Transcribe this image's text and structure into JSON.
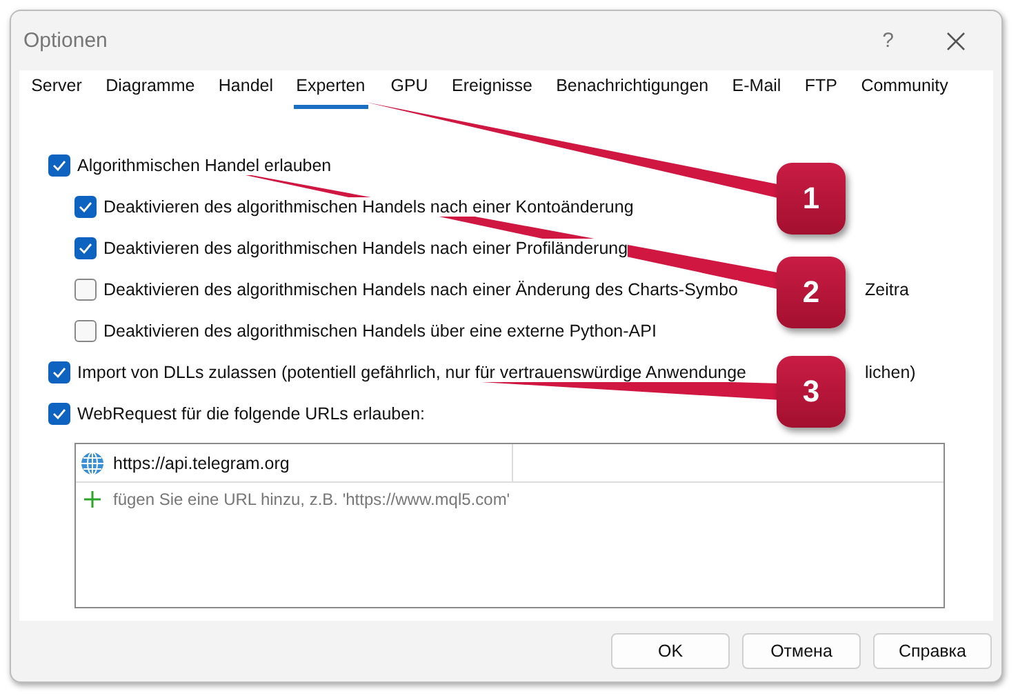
{
  "window": {
    "title": "Optionen",
    "help": "?"
  },
  "tabs": [
    {
      "label": "Server",
      "selected": false
    },
    {
      "label": "Diagramme",
      "selected": false
    },
    {
      "label": "Handel",
      "selected": false
    },
    {
      "label": "Experten",
      "selected": true
    },
    {
      "label": "GPU",
      "selected": false
    },
    {
      "label": "Ereignisse",
      "selected": false
    },
    {
      "label": "Benachrichtigungen",
      "selected": false
    },
    {
      "label": "E-Mail",
      "selected": false
    },
    {
      "label": "FTP",
      "selected": false
    },
    {
      "label": "Community",
      "selected": false
    }
  ],
  "options": [
    {
      "label": "Algorithmischen Handel erlauben",
      "checked": true,
      "children": [
        {
          "label": "Deaktivieren des algorithmischen Handels nach einer Kontoänderung",
          "checked": true
        },
        {
          "label": "Deaktivieren des algorithmischen Handels nach einer Profiländerung",
          "checked": true
        },
        {
          "label": "Deaktivieren des algorithmischen Handels nach einer Änderung des Charts-Symbo",
          "tail": "Zeitra",
          "checked": false
        },
        {
          "label": "Deaktivieren des algorithmischen Handels über eine externe Python-API",
          "checked": false
        }
      ]
    },
    {
      "label": "Import von DLLs zulassen (potentiell gefährlich, nur für vertrauenswürdige Anwendunge",
      "tail": "lichen)",
      "checked": true
    },
    {
      "label": "WebRequest für die folgende URLs erlauben:",
      "checked": true
    }
  ],
  "url_table": {
    "rows": [
      {
        "url": "https://api.telegram.org"
      }
    ],
    "add_hint": "fügen Sie eine URL hinzu, z.B. 'https://www.mql5.com'"
  },
  "buttons": [
    "OK",
    "Отмена",
    "Справка"
  ],
  "callouts": [
    "1",
    "2",
    "3"
  ]
}
